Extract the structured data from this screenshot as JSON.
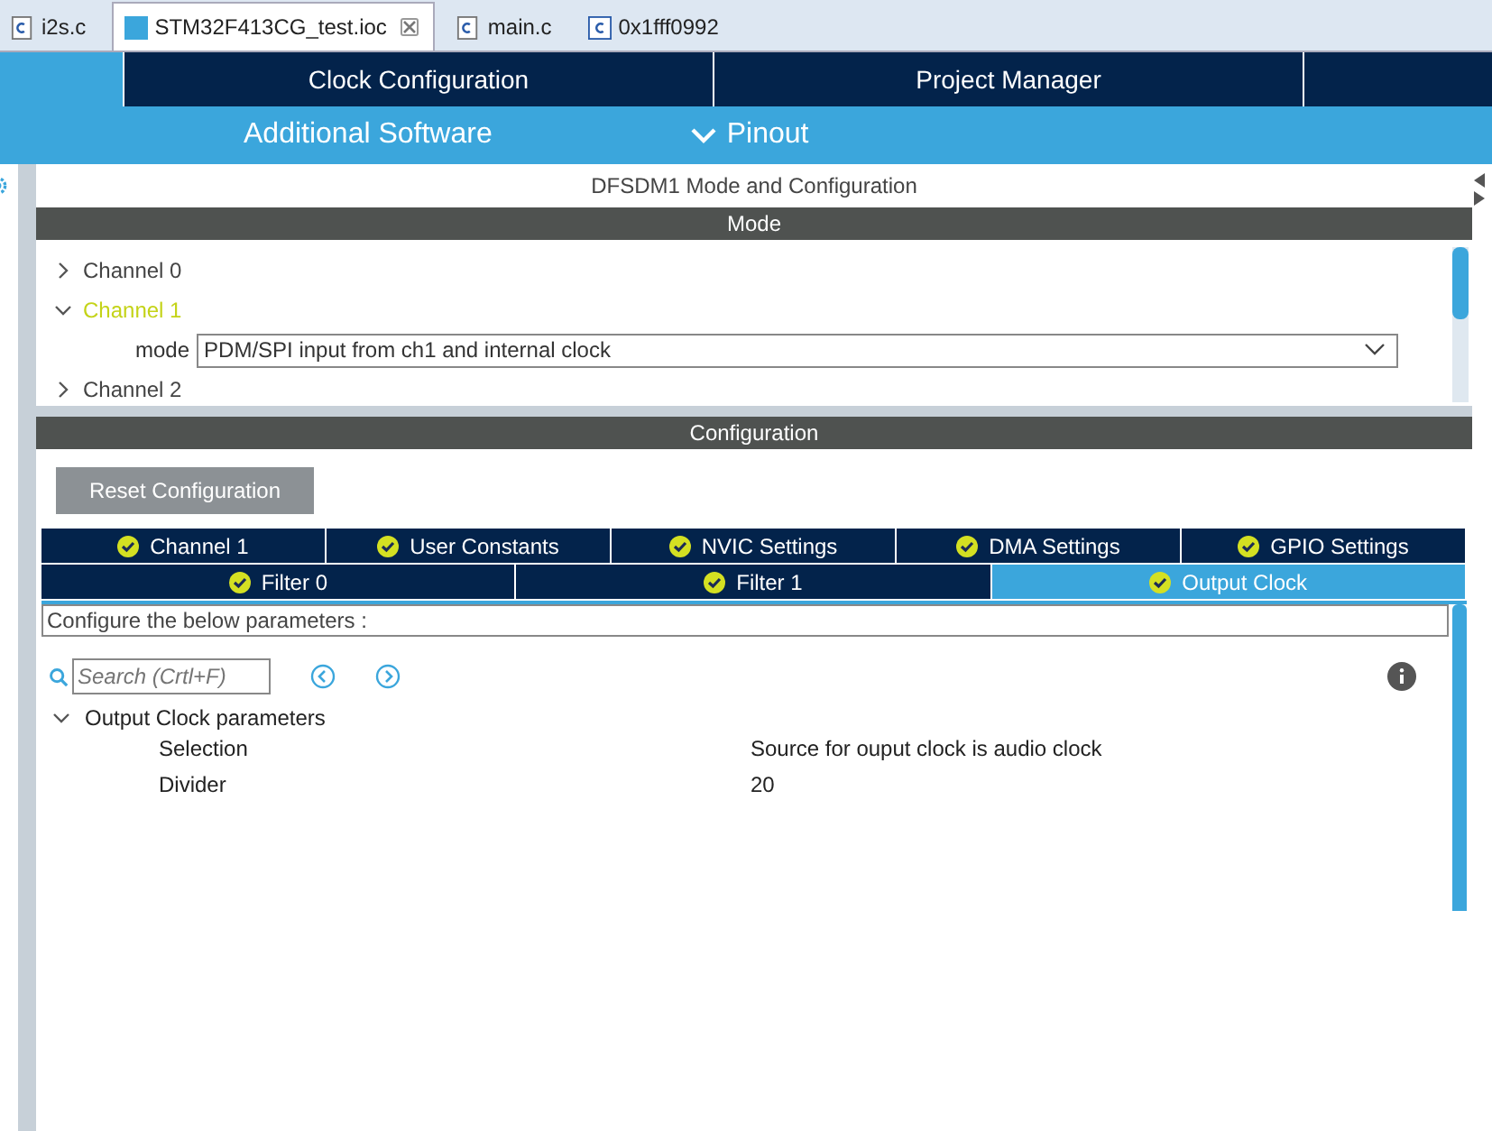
{
  "editor_tabs": [
    {
      "label": "i2s.c",
      "kind": "c",
      "selected": false
    },
    {
      "label": "STM32F413CG_test.ioc",
      "kind": "mx",
      "selected": true
    },
    {
      "label": "main.c",
      "kind": "c",
      "selected": false
    },
    {
      "label": "0x1fff0992",
      "kind": "asm",
      "selected": false
    }
  ],
  "top_nav": [
    {
      "label": "Clock Configuration"
    },
    {
      "label": "Project Manager"
    }
  ],
  "sub_nav": [
    {
      "label": "Additional Software",
      "expanded": false
    },
    {
      "label": "Pinout",
      "expanded": true
    }
  ],
  "panel_title": "DFSDM1 Mode and Configuration",
  "mode": {
    "header": "Mode",
    "channels": [
      {
        "label": "Channel 0",
        "expanded": false
      },
      {
        "label": "Channel 1",
        "expanded": true,
        "field_label": "mode",
        "value": "PDM/SPI input from ch1 and internal clock"
      },
      {
        "label": "Channel 2",
        "expanded": false
      }
    ]
  },
  "configuration": {
    "header": "Configuration",
    "reset_button": "Reset Configuration",
    "tab_rows": [
      [
        {
          "label": "Channel 1",
          "selected": false
        },
        {
          "label": "User Constants",
          "selected": false
        },
        {
          "label": "NVIC Settings",
          "selected": false
        },
        {
          "label": "DMA Settings",
          "selected": false
        },
        {
          "label": "GPIO Settings",
          "selected": false
        }
      ],
      [
        {
          "label": "Filter 0",
          "selected": false
        },
        {
          "label": "Filter 1",
          "selected": false
        },
        {
          "label": "Output Clock",
          "selected": true
        }
      ]
    ],
    "hint": "Configure the below parameters :",
    "search": {
      "placeholder": "Search (Crtl+F)"
    },
    "group": {
      "label": "Output Clock parameters",
      "expanded": true,
      "params": [
        {
          "name": "Selection",
          "value": "Source for ouput clock is audio clock"
        },
        {
          "name": "Divider",
          "value": "20"
        }
      ]
    }
  }
}
